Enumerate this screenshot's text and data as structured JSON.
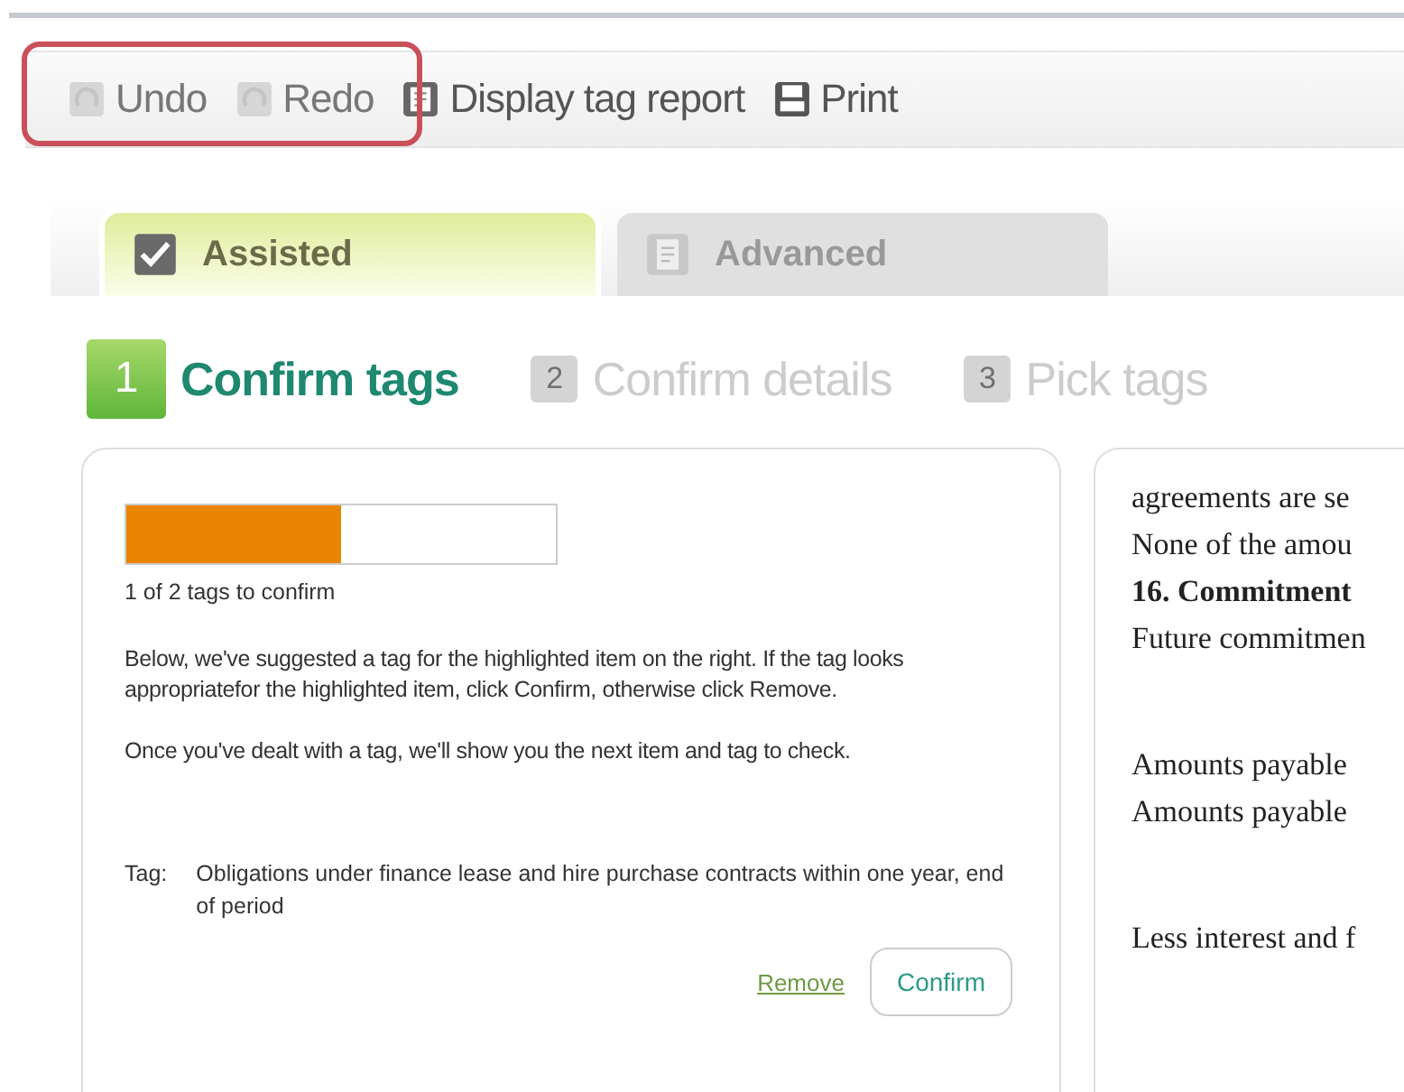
{
  "toolbar": [
    {
      "label": "Undo",
      "kind": "undo",
      "disabled": true
    },
    {
      "label": "Redo",
      "kind": "redo",
      "disabled": true
    },
    {
      "label": "Display tag report",
      "kind": "report",
      "disabled": false
    },
    {
      "label": "Print",
      "kind": "print",
      "disabled": false
    }
  ],
  "tabs": [
    {
      "label": "Assisted",
      "kind": "check",
      "selected": true
    },
    {
      "label": "Advanced",
      "kind": "report",
      "selected": false
    }
  ],
  "steps": [
    {
      "number": "1",
      "label": "Confirm tags",
      "selected": true
    },
    {
      "number": "2",
      "label": "Confirm details",
      "selected": false
    },
    {
      "number": "3",
      "label": "Pick tags",
      "selected": false
    }
  ],
  "panel": {
    "progress": {
      "level": 0.5
    },
    "progress_text": "1 of 2 tags to confirm",
    "instructions": [
      "Below, we've suggested a tag for the highlighted item on the right. If the tag looks appropriatefor the highlighted item, click Confirm, otherwise click Remove.",
      "Once you've dealt with a tag, we'll show you the next item and tag to check."
    ],
    "tag_label": "Tag:",
    "tag_value": "Obligations under finance lease and hire purchase contracts within one year, end of period",
    "remove_link": "Remove",
    "confirm_button": "Confirm"
  },
  "document": {
    "blocks": [
      {
        "lines": [
          {
            "text": "agreements are se",
            "bold": false
          },
          {
            "text": "None of the amou",
            "bold": false
          },
          {
            "text": "16. Commitment",
            "bold": true
          },
          {
            "text": "Future commitmen",
            "bold": false
          }
        ]
      },
      {
        "lines": [
          {
            "text": "Amounts payable",
            "bold": false
          },
          {
            "text": "Amounts payable",
            "bold": false
          }
        ]
      },
      {
        "lines": [
          {
            "text": "Less interest and f",
            "bold": false
          }
        ]
      }
    ]
  }
}
